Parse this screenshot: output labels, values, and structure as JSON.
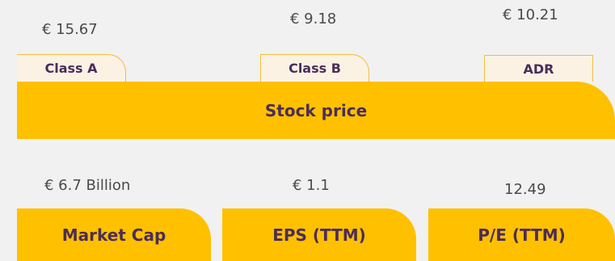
{
  "stock_price": {
    "title": "Stock price",
    "classes": [
      {
        "label": "Class A",
        "value": "€ 15.67"
      },
      {
        "label": "Class B",
        "value": "€ 9.18"
      },
      {
        "label": "ADR",
        "value": "€ 10.21"
      }
    ]
  },
  "metrics": [
    {
      "label": "Market Cap",
      "value": "€ 6.7 Billion"
    },
    {
      "label": "EPS (TTM)",
      "value": "€ 1.1"
    },
    {
      "label": "P/E (TTM)",
      "value": "12.49"
    }
  ],
  "colors": {
    "background": "#f1f1f1",
    "accent_yellow": "#ffc000",
    "label_purple": "#4b2d58",
    "value_gray": "#4a4a4a",
    "tab_fill": "#fbf2e4"
  }
}
